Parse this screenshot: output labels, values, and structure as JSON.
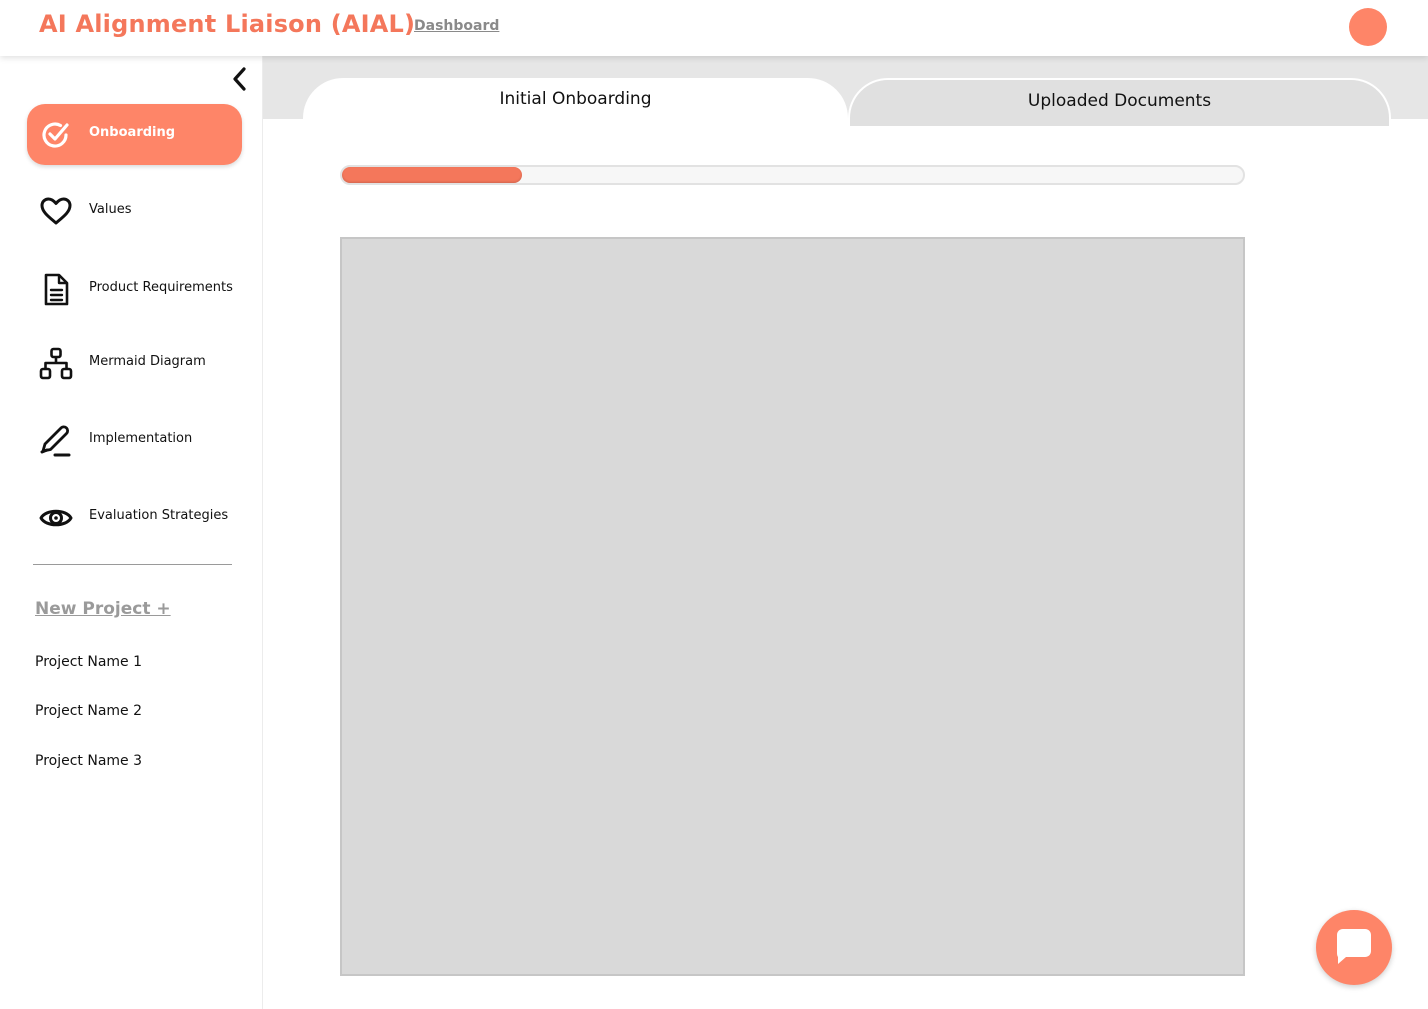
{
  "header": {
    "app_title": "AI Alignment Liaison (AIAL)",
    "nav_link": "Dashboard",
    "avatar_icon": "user-avatar"
  },
  "sidebar": {
    "collapse_icon": "chevron-left-icon",
    "items": [
      {
        "label": "Onboarding",
        "icon": "check-circle-icon",
        "active": true
      },
      {
        "label": "Values",
        "icon": "heart-icon",
        "active": false
      },
      {
        "label": "Product Requirements",
        "icon": "document-icon",
        "active": false
      },
      {
        "label": "Mermaid Diagram",
        "icon": "hierarchy-icon",
        "active": false
      },
      {
        "label": "Implementation",
        "icon": "pen-icon",
        "active": false
      },
      {
        "label": "Evaluation Strategies",
        "icon": "eye-icon",
        "active": false
      }
    ],
    "new_project_label": "New Project +",
    "projects": [
      "Project Name 1",
      "Project Name 2",
      "Project Name 3"
    ]
  },
  "main": {
    "tabs": [
      {
        "label": "Initial Onboarding",
        "active": true
      },
      {
        "label": "Uploaded Documents",
        "active": false
      }
    ],
    "progress_fraction": 0.2,
    "chat_icon": "chat-bubble-icon"
  },
  "colors": {
    "accent": "#f4775b",
    "accent_light": "#fe8568",
    "panel": "#d9d9d9",
    "muted_text": "#9a9a9a"
  }
}
